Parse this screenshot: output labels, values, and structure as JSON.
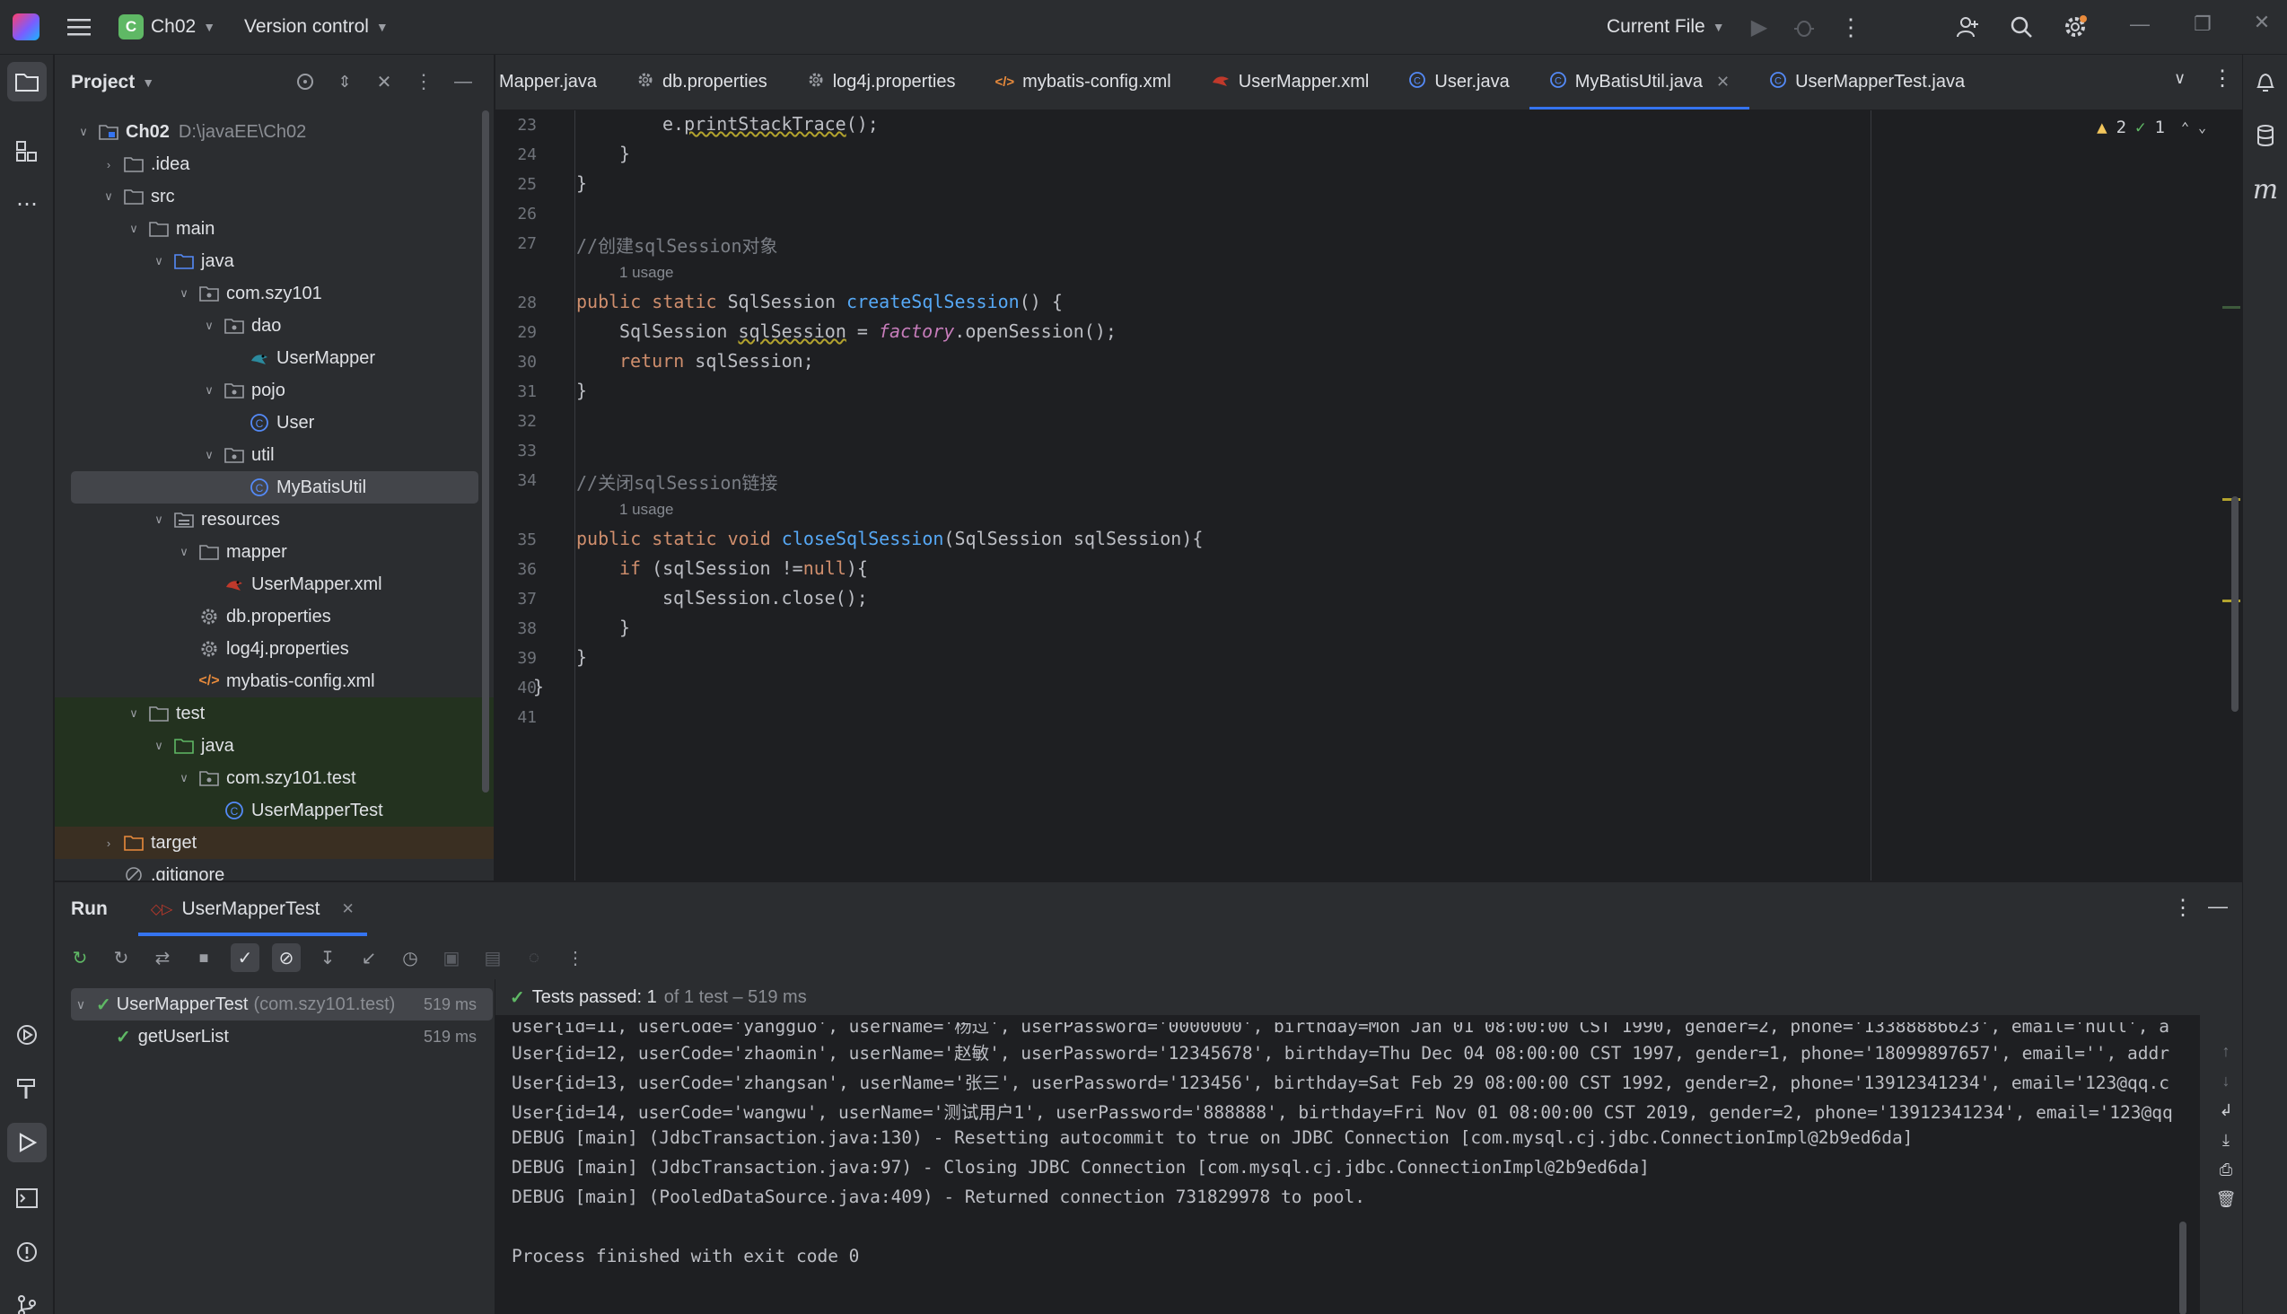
{
  "titlebar": {
    "project_letter": "C",
    "project_name": "Ch02",
    "vcs": "Version control",
    "run_config": "Current File"
  },
  "project_panel": {
    "title": "Project",
    "root_name": "Ch02",
    "root_path": "D:\\javaEE\\Ch02",
    "items": [
      {
        "label": ".idea"
      },
      {
        "label": "src"
      },
      {
        "label": "main"
      },
      {
        "label": "java"
      },
      {
        "label": "com.szy101"
      },
      {
        "label": "dao"
      },
      {
        "label": "UserMapper"
      },
      {
        "label": "pojo"
      },
      {
        "label": "User"
      },
      {
        "label": "util"
      },
      {
        "label": "MyBatisUtil"
      },
      {
        "label": "resources"
      },
      {
        "label": "mapper"
      },
      {
        "label": "UserMapper.xml"
      },
      {
        "label": "db.properties"
      },
      {
        "label": "log4j.properties"
      },
      {
        "label": "mybatis-config.xml"
      },
      {
        "label": "test"
      },
      {
        "label": "java"
      },
      {
        "label": "com.szy101.test"
      },
      {
        "label": "UserMapperTest"
      },
      {
        "label": "target"
      },
      {
        "label": ".gitignore"
      }
    ]
  },
  "tabs": [
    {
      "label": "Mapper.java"
    },
    {
      "label": "db.properties"
    },
    {
      "label": "log4j.properties"
    },
    {
      "label": "mybatis-config.xml"
    },
    {
      "label": "UserMapper.xml"
    },
    {
      "label": "User.java"
    },
    {
      "label": "MyBatisUtil.java"
    },
    {
      "label": "UserMapperTest.java"
    }
  ],
  "editor": {
    "warnings": "2",
    "checks": "1",
    "line_numbers": [
      "23",
      "24",
      "25",
      "26",
      "27",
      "28",
      "29",
      "30",
      "31",
      "32",
      "33",
      "34",
      "35",
      "36",
      "37",
      "38",
      "39",
      "40",
      "41"
    ],
    "usage_hint": "1 usage",
    "code": {
      "l23_a": "e.",
      "l23_b": "printStackTrace",
      "l23_c": "();",
      "l24": "}",
      "l25": "}",
      "l27": "//创建sqlSession对象",
      "l28_kw": "public static",
      "l28_type": " SqlSession ",
      "l28_fn": "createSqlSession",
      "l28_rest": "() {",
      "l29_a": "SqlSession ",
      "l29_b": "sqlSession",
      "l29_c": " = ",
      "l29_d": "factory",
      "l29_e": ".openSession();",
      "l30_kw": "return",
      "l30_rest": " sqlSession;",
      "l31": "}",
      "l34": "//关闭sqlSession链接",
      "l35_kw": "public static void",
      "l35_fn": "closeSqlSession",
      "l35_rest": "(SqlSession sqlSession){",
      "l36_kw": "if",
      "l36_a": " (sqlSession !=",
      "l36_null": "null",
      "l36_b": "){",
      "l37": "sqlSession.close();",
      "l38": "}",
      "l39": "}",
      "l40": "}"
    }
  },
  "run_panel": {
    "title": "Run",
    "tab": "UserMapperTest",
    "tree_root": "UserMapperTest",
    "tree_root_pkg": "(com.szy101.test)",
    "tree_root_ms": "519 ms",
    "tree_child": "getUserList",
    "tree_child_ms": "519 ms",
    "status_strong": "Tests passed: 1",
    "status_rest": "of 1 test – 519 ms",
    "console_lines": [
      "User{id=11, userCode='yangguo', userName='杨过', userPassword='0000000', birthday=Mon Jan 01 08:00:00 CST 1990, gender=2, phone='13388886623', email='null', a",
      "User{id=12, userCode='zhaomin', userName='赵敏', userPassword='12345678', birthday=Thu Dec 04 08:00:00 CST 1997, gender=1, phone='18099897657', email='', addr",
      "User{id=13, userCode='zhangsan', userName='张三', userPassword='123456', birthday=Sat Feb 29 08:00:00 CST 1992, gender=2, phone='13912341234', email='123@qq.c",
      "User{id=14, userCode='wangwu', userName='测试用户1', userPassword='888888', birthday=Fri Nov 01 08:00:00 CST 2019, gender=2, phone='13912341234', email='123@qq",
      "DEBUG [main] (JdbcTransaction.java:130) - Resetting autocommit to true on JDBC Connection [com.mysql.cj.jdbc.ConnectionImpl@2b9ed6da]",
      "DEBUG [main] (JdbcTransaction.java:97) - Closing JDBC Connection [com.mysql.cj.jdbc.ConnectionImpl@2b9ed6da]",
      "DEBUG [main] (PooledDataSource.java:409) - Returned connection 731829978 to pool.",
      "",
      "Process finished with exit code 0"
    ]
  },
  "colors": {
    "accent": "#3574f0",
    "success": "#5fb865",
    "keyword": "#cf8e6d",
    "function": "#56a8f5",
    "field": "#c77dbb"
  }
}
